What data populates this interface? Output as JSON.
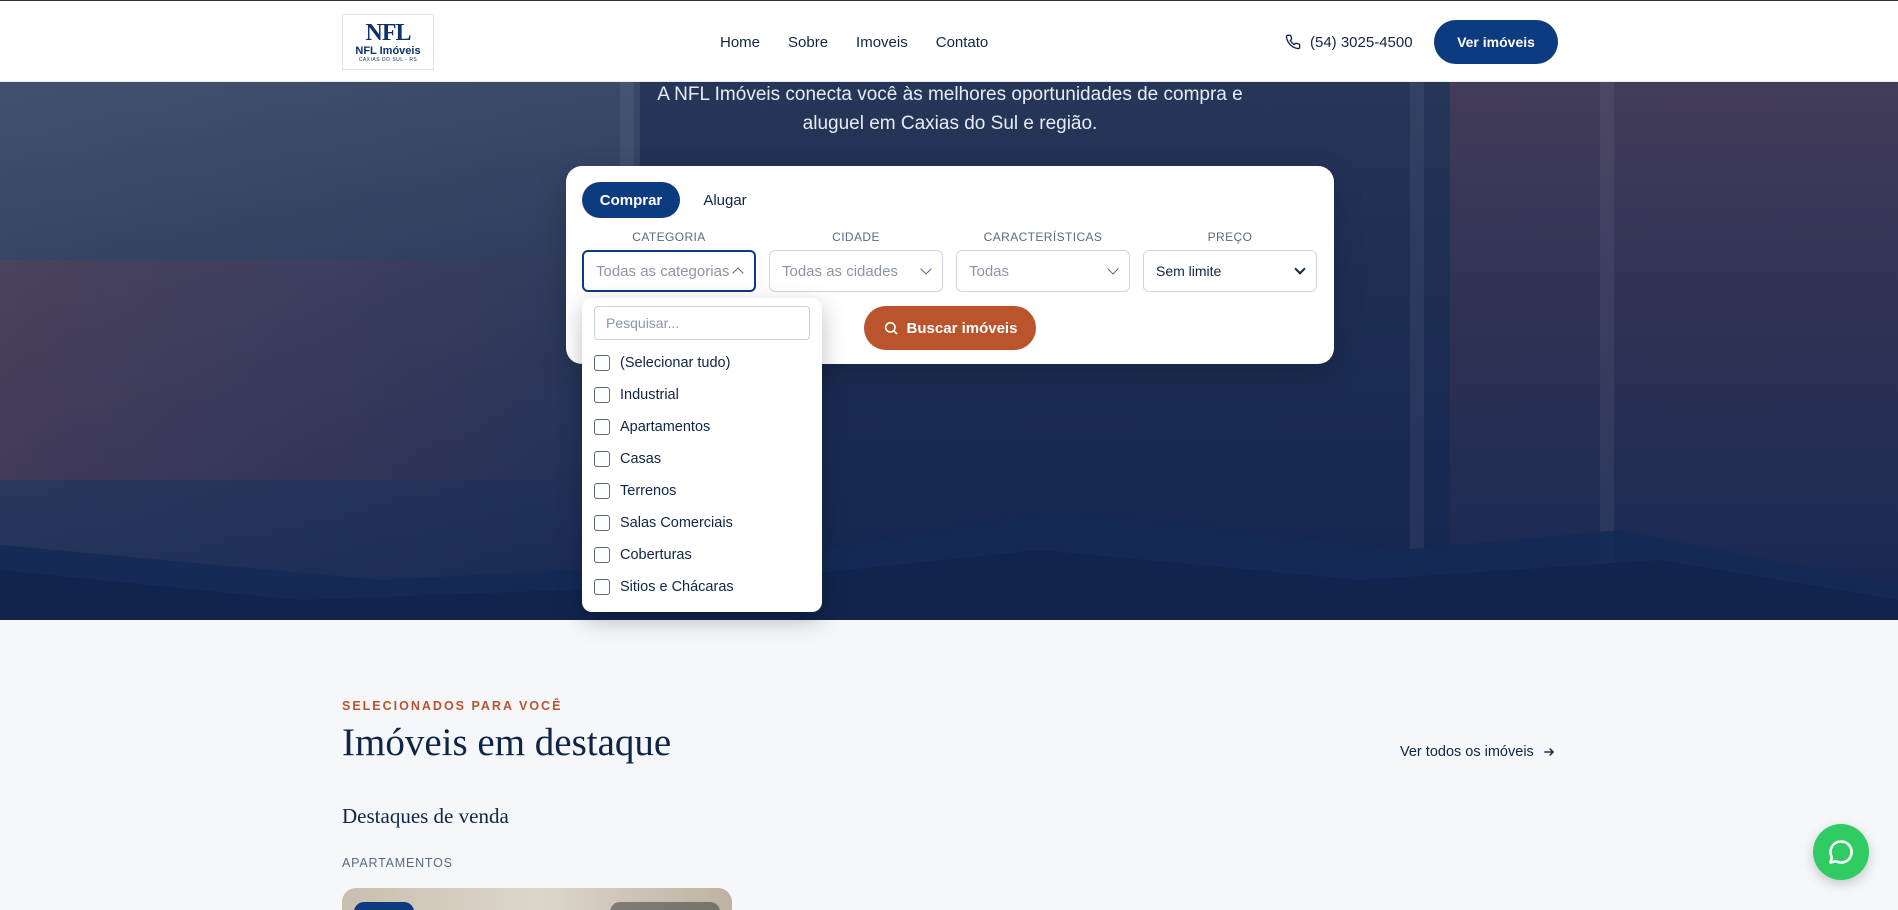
{
  "header": {
    "logo": {
      "mark": "NFL",
      "name": "NFL Imóveis",
      "sub": "CAXIAS DO SUL - RS"
    },
    "nav": [
      "Home",
      "Sobre",
      "Imoveis",
      "Contato"
    ],
    "phone": "(54) 3025-4500",
    "cta": "Ver imóveis"
  },
  "hero": {
    "line1": "A NFL Imóveis conecta você às melhores oportunidades de compra e",
    "line2": "aluguel em Caxias do Sul e região."
  },
  "search": {
    "tabs": [
      "Comprar",
      "Alugar"
    ],
    "active_tab": "Comprar",
    "fields": [
      {
        "label": "CATEGORIA",
        "value": "Todas as categorias"
      },
      {
        "label": "CIDADE",
        "value": "Todas as cidades"
      },
      {
        "label": "CARACTERÍSTICAS",
        "value": "Todas"
      },
      {
        "label": "PREÇO",
        "value": "Sem limite"
      }
    ],
    "button": "Buscar imóveis"
  },
  "dropdown": {
    "placeholder": "Pesquisar...",
    "items": [
      "(Selecionar tudo)",
      "Industrial",
      "Apartamentos",
      "Casas",
      "Terrenos",
      "Salas Comerciais",
      "Coberturas",
      "Sitios e Chácaras"
    ]
  },
  "featured": {
    "eyebrow": "SELECIONADOS PARA VOCÊ",
    "title": "Imóveis em destaque",
    "see_all": "Ver todos os imóveis",
    "subtitle": "Destaques de venda",
    "category": "APARTAMENTOS"
  },
  "colors": {
    "primary": "#0c3b7f",
    "accent": "#b9542c",
    "whatsapp": "#2ecc63"
  }
}
